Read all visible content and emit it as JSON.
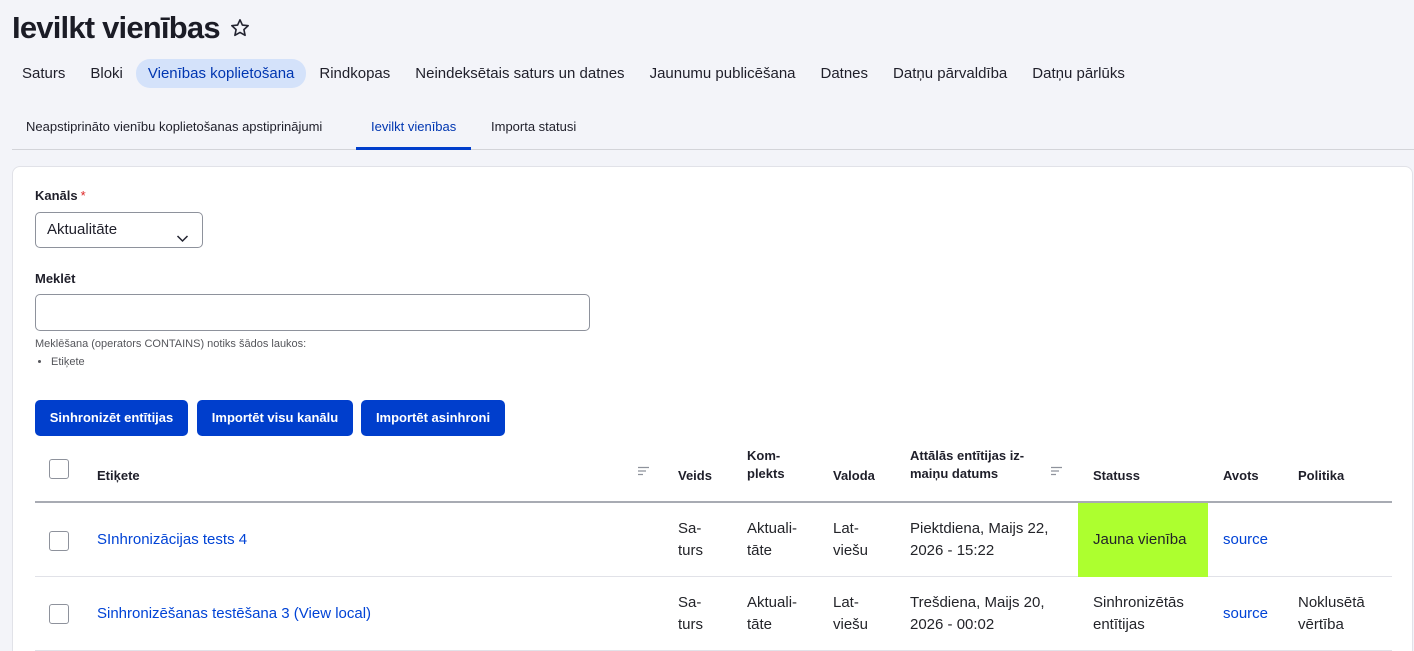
{
  "page": {
    "title": "Ievilkt vienības"
  },
  "primary_tabs": [
    {
      "label": "Saturs"
    },
    {
      "label": "Bloki"
    },
    {
      "label": "Vienības koplietošana",
      "active": true
    },
    {
      "label": "Rindkopas"
    },
    {
      "label": "Neindeksētais saturs un datnes"
    },
    {
      "label": "Jaunumu publicēšana"
    },
    {
      "label": "Datnes"
    },
    {
      "label": "Datņu pārvaldība"
    },
    {
      "label": "Datņu pārlūks"
    }
  ],
  "secondary_tabs": [
    {
      "label": "Neapstiprināto vienību koplietošanas apstiprinājumi"
    },
    {
      "label": "Ievilkt vienības",
      "active": true
    },
    {
      "label": "Importa statusi"
    }
  ],
  "form": {
    "channel_label": "Kanāls",
    "required_mark": "*",
    "channel_value": "Aktualitāte",
    "search_label": "Meklēt",
    "search_value": "",
    "search_help": "Meklēšana (operators CONTAINS) notiks šādos laukos:",
    "search_fields": [
      "Etiķete"
    ]
  },
  "buttons": {
    "sync": "Sinhronizēt entītijas",
    "import_all": "Importēt visu kanālu",
    "import_async": "Importēt asinhroni"
  },
  "table": {
    "headers": {
      "label": "Etiķete",
      "type": "Veids",
      "bundle_l1": "Kom-",
      "bundle_l2": "plekts",
      "language": "Valoda",
      "date_l1": "Attālās entītijas iz-",
      "date_l2": "maiņu datums",
      "status": "Statuss",
      "source": "Avots",
      "policy": "Politika"
    },
    "rows": [
      {
        "label": "SInhronizācijas tests 4",
        "type_l1": "Sa-",
        "type_l2": "turs",
        "bundle_l1": "Aktuali-",
        "bundle_l2": "tāte",
        "lang_l1": "Lat-",
        "lang_l2": "viešu",
        "date_l1": "Piektdiena, Maijs 22,",
        "date_l2": "2026 - 15:22",
        "status_l1": "Jauna vienība",
        "status_l2": "",
        "status_color": "#adff2f",
        "source": "source",
        "policy_l1": "",
        "policy_l2": ""
      },
      {
        "label": "Sinhronizēšanas testēšana 3 (View local)",
        "type_l1": "Sa-",
        "type_l2": "turs",
        "bundle_l1": "Aktuali-",
        "bundle_l2": "tāte",
        "lang_l1": "Lat-",
        "lang_l2": "viešu",
        "date_l1": "Trešdiena, Maijs 20,",
        "date_l2": "2026 - 00:02",
        "status_l1": "Sinhronizētās",
        "status_l2": "entītijas",
        "source": "source",
        "policy_l1": "Noklusētā",
        "policy_l2": "vērtība"
      }
    ]
  },
  "colors": {
    "accent": "#003ecc",
    "active_tab_bg": "#d4e2fa",
    "link": "#0043d6"
  },
  "icons": {
    "favorite": "star-icon",
    "dropdown": "chevron-down-icon",
    "sort": "sort-icon"
  }
}
